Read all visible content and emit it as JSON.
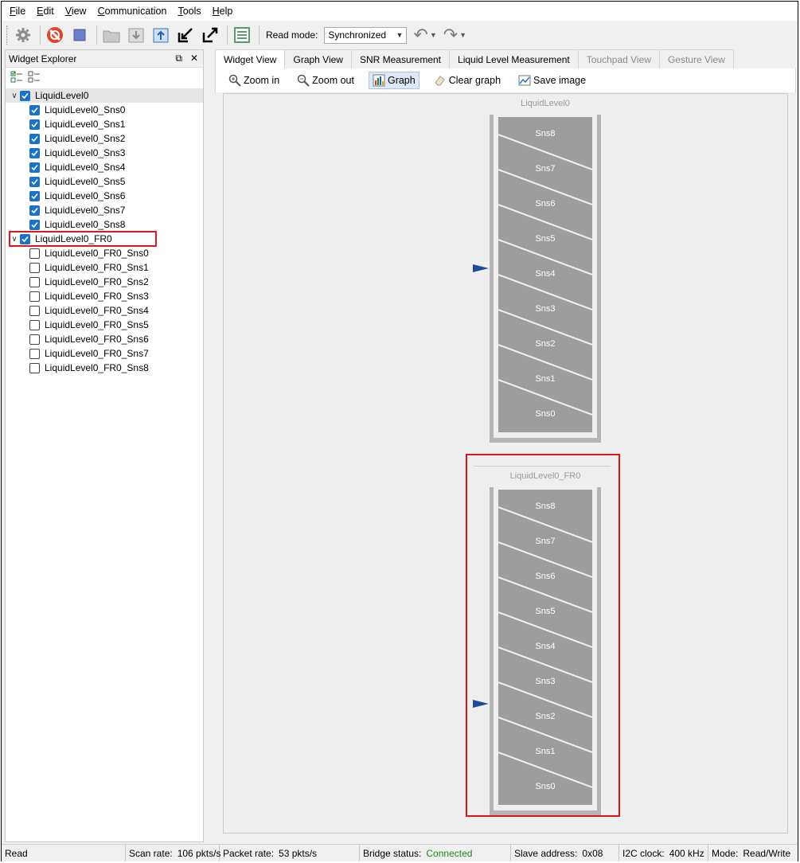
{
  "menu": [
    "File",
    "Edit",
    "View",
    "Communication",
    "Tools",
    "Help"
  ],
  "toolbar": {
    "read_mode_label": "Read mode:",
    "read_mode_value": "Synchronized"
  },
  "left_panel": {
    "title": "Widget Explorer",
    "groups": [
      {
        "label": "LiquidLevel0",
        "checked": true,
        "items": [
          {
            "label": "LiquidLevel0_Sns0",
            "checked": true
          },
          {
            "label": "LiquidLevel0_Sns1",
            "checked": true
          },
          {
            "label": "LiquidLevel0_Sns2",
            "checked": true
          },
          {
            "label": "LiquidLevel0_Sns3",
            "checked": true
          },
          {
            "label": "LiquidLevel0_Sns4",
            "checked": true
          },
          {
            "label": "LiquidLevel0_Sns5",
            "checked": true
          },
          {
            "label": "LiquidLevel0_Sns6",
            "checked": true
          },
          {
            "label": "LiquidLevel0_Sns7",
            "checked": true
          },
          {
            "label": "LiquidLevel0_Sns8",
            "checked": true
          }
        ]
      },
      {
        "label": "LiquidLevel0_FR0",
        "checked": true,
        "highlighted": true,
        "items": [
          {
            "label": "LiquidLevel0_FR0_Sns0",
            "checked": false
          },
          {
            "label": "LiquidLevel0_FR0_Sns1",
            "checked": false
          },
          {
            "label": "LiquidLevel0_FR0_Sns2",
            "checked": false
          },
          {
            "label": "LiquidLevel0_FR0_Sns3",
            "checked": false
          },
          {
            "label": "LiquidLevel0_FR0_Sns4",
            "checked": false
          },
          {
            "label": "LiquidLevel0_FR0_Sns5",
            "checked": false
          },
          {
            "label": "LiquidLevel0_FR0_Sns6",
            "checked": false
          },
          {
            "label": "LiquidLevel0_FR0_Sns7",
            "checked": false
          },
          {
            "label": "LiquidLevel0_FR0_Sns8",
            "checked": false
          }
        ]
      }
    ]
  },
  "tabs": [
    {
      "label": "Widget View",
      "active": true,
      "enabled": true
    },
    {
      "label": "Graph View",
      "active": false,
      "enabled": true
    },
    {
      "label": "SNR Measurement",
      "active": false,
      "enabled": true
    },
    {
      "label": "Liquid Level Measurement",
      "active": false,
      "enabled": true
    },
    {
      "label": "Touchpad View",
      "active": false,
      "enabled": false
    },
    {
      "label": "Gesture View",
      "active": false,
      "enabled": false
    }
  ],
  "view_toolbar": {
    "zoom_in": "Zoom in",
    "zoom_out": "Zoom out",
    "graph": "Graph",
    "clear_graph": "Clear graph",
    "save_image": "Save image"
  },
  "widgets": [
    {
      "title": "LiquidLevel0",
      "segments": [
        "Sns8",
        "Sns7",
        "Sns6",
        "Sns5",
        "Sns4",
        "Sns3",
        "Sns2",
        "Sns1",
        "Sns0"
      ],
      "level_fraction": 0.52,
      "highlighted": false
    },
    {
      "title": "LiquidLevel0_FR0",
      "segments": [
        "Sns8",
        "Sns7",
        "Sns6",
        "Sns5",
        "Sns4",
        "Sns3",
        "Sns2",
        "Sns1",
        "Sns0"
      ],
      "level_fraction": 0.32,
      "highlighted": true
    }
  ],
  "status": {
    "read": "Read",
    "scan_rate_label": "Scan rate:",
    "scan_rate": "106 pkts/s",
    "packet_rate_label": "Packet rate:",
    "packet_rate": "53 pkts/s",
    "bridge_label": "Bridge status:",
    "bridge": "Connected",
    "slave_label": "Slave address:",
    "slave": "0x08",
    "i2c_label": "I2C clock:",
    "i2c": "400 kHz",
    "mode_label": "Mode:",
    "mode": "Read/Write"
  },
  "colors": {
    "accent": "#1a73c8",
    "highlight": "#e3131b",
    "marker": "#1e4a9c",
    "connected": "#1a8a1a"
  }
}
